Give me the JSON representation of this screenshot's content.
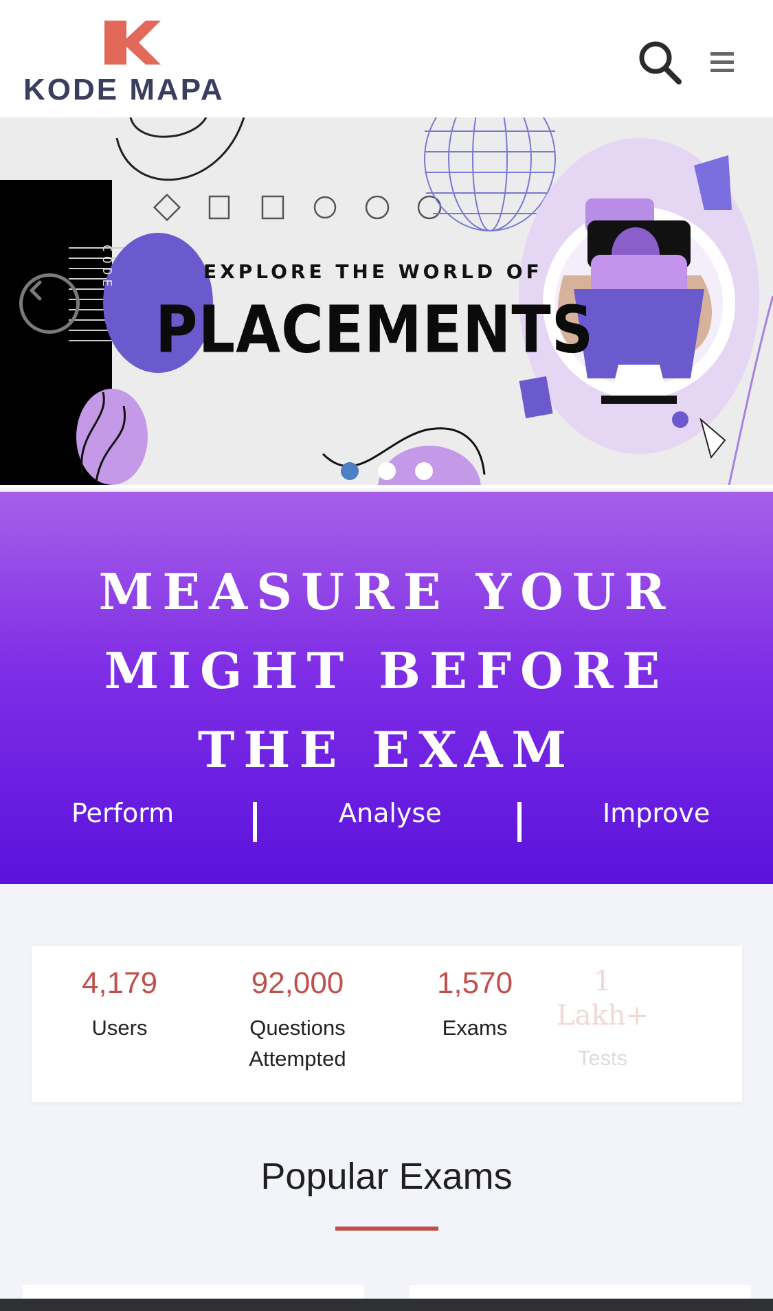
{
  "header": {
    "logo_text": "KODE MAPA",
    "colors": {
      "brand_orange": "#e2685a",
      "brand_navy": "#3a3d5c"
    }
  },
  "banner": {
    "kicker": "EXPLORE THE WORLD OF",
    "title": "PLACEMENTS",
    "side_label": "CODE",
    "slides": 3,
    "active_slide": 1
  },
  "hero": {
    "title": "MEASURE YOUR MIGHT BEFORE THE EXAM",
    "steps": [
      "Perform",
      "Analyse",
      "Improve"
    ]
  },
  "stats": [
    {
      "value": "4,179",
      "label": "Users"
    },
    {
      "value": "92,000",
      "label": "Questions Attempted"
    },
    {
      "value": "1,570",
      "label": "Exams"
    },
    {
      "value": "1 Lakh+",
      "label": "Tests"
    }
  ],
  "popular": {
    "title": "Popular Exams"
  },
  "icons": [
    "search-icon",
    "hamburger-menu-icon",
    "chevron-left-icon"
  ]
}
